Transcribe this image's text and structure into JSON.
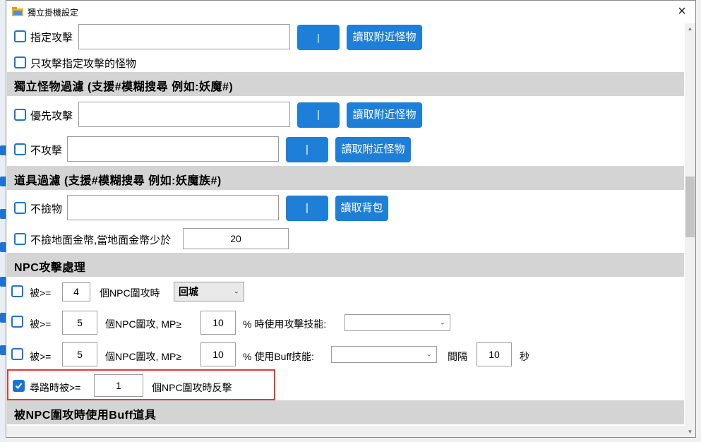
{
  "window": {
    "title": "獨立掛機設定",
    "close_label": "×"
  },
  "specify_attack": {
    "label": "指定攻擊",
    "value": "",
    "sep_label": "|",
    "fetch_label": "讀取附近怪物"
  },
  "only_attack": {
    "label": "只攻擊指定攻擊的怪物"
  },
  "monster_filter": {
    "header": "獨立怪物過濾 (支援#模糊搜尋 例如:妖魔#)",
    "priority": {
      "label": "優先攻擊",
      "value": "",
      "sep_label": "|",
      "fetch_label": "讀取附近怪物"
    },
    "no_attack": {
      "label": "不攻擊",
      "value": "",
      "sep_label": "|",
      "fetch_label": "讀取附近怪物"
    }
  },
  "item_filter": {
    "header": "道具過濾 (支援#模糊搜尋 例如:妖魔族#)",
    "no_pick": {
      "label": "不撿物",
      "value": "",
      "sep_label": "|",
      "fetch_label": "讀取背包"
    },
    "no_gold": {
      "label": "不撿地面金幣,當地面金幣少於",
      "value": "20"
    }
  },
  "npc_attack": {
    "header": "NPC攻擊處理",
    "row1": {
      "prefix": "被>=",
      "count": "4",
      "text": "個NPC圍攻時",
      "action": "回城"
    },
    "row2": {
      "prefix": "被>=",
      "count": "5",
      "text": "個NPC圍攻, MP≥",
      "mp": "10",
      "suffix": "% 時使用攻擊技能:",
      "skill": ""
    },
    "row3": {
      "prefix": "被>=",
      "count": "5",
      "text": "個NPC圍攻, MP≥",
      "mp": "10",
      "suffix": "% 使用Buff技能:",
      "skill": "",
      "interval_label": "間隔",
      "interval": "10",
      "unit": "秒"
    },
    "row4": {
      "prefix": "尋路時被>=",
      "count": "1",
      "text": "個NPC圍攻時反擊"
    }
  },
  "buff_items": {
    "header": "被NPC圍攻時使用Buff道具"
  },
  "colors": {
    "accent": "#1e7fd8",
    "highlight": "#e53935",
    "section_bg": "#d4d4d4"
  }
}
